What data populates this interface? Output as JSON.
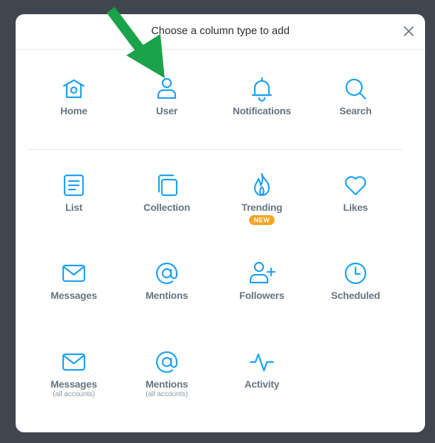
{
  "modal": {
    "title": "Choose a column type to add",
    "close_icon": "close-icon",
    "accent_color": "#1da1f2",
    "badge_color": "#f6a623"
  },
  "tiles": [
    {
      "label": "Home",
      "icon": "home-icon"
    },
    {
      "label": "User",
      "icon": "user-icon"
    },
    {
      "label": "Notifications",
      "icon": "bell-icon"
    },
    {
      "label": "Search",
      "icon": "search-icon"
    },
    {
      "label": "List",
      "icon": "list-icon"
    },
    {
      "label": "Collection",
      "icon": "collection-icon"
    },
    {
      "label": "Trending",
      "icon": "flame-icon",
      "badge": "NEW"
    },
    {
      "label": "Likes",
      "icon": "heart-icon"
    },
    {
      "label": "Messages",
      "icon": "envelope-icon"
    },
    {
      "label": "Mentions",
      "icon": "at-icon"
    },
    {
      "label": "Followers",
      "icon": "add-user-icon"
    },
    {
      "label": "Scheduled",
      "icon": "clock-icon"
    },
    {
      "label": "Messages",
      "sub": "(all accounts)",
      "icon": "envelope-icon"
    },
    {
      "label": "Mentions",
      "sub": "(all accounts)",
      "icon": "at-icon"
    },
    {
      "label": "Activity",
      "icon": "activity-icon"
    }
  ],
  "annotation": {
    "icon": "green-arrow-icon",
    "color": "#1aa34a"
  }
}
